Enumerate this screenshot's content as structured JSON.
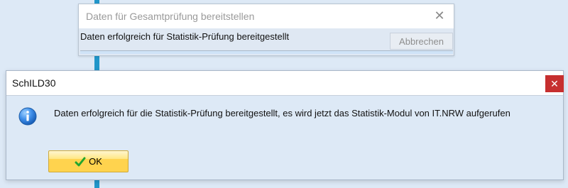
{
  "background_window": {
    "title": "Daten für Gesamtprüfung bereitstellen",
    "close_icon": "close-icon",
    "status_message": "Daten erfolgreich für Statistik-Prüfung bereitgestellt",
    "cancel_label": "Abbrechen",
    "progress_fraction": 1.0
  },
  "dialog": {
    "title": "SchILD30",
    "close_icon": "close-icon",
    "info_icon": "info-icon",
    "message": "Daten erfolgreich für die Statistik-Prüfung bereitgestellt, es wird jetzt das Statistik-Modul von IT.NRW aufgerufen",
    "ok_label": "OK",
    "ok_icon": "check-icon"
  },
  "colors": {
    "accent_blue": "#2196c9",
    "dialog_background": "#dde9f6",
    "close_red": "#c62f2f",
    "ok_yellow": "#ffd34e"
  }
}
